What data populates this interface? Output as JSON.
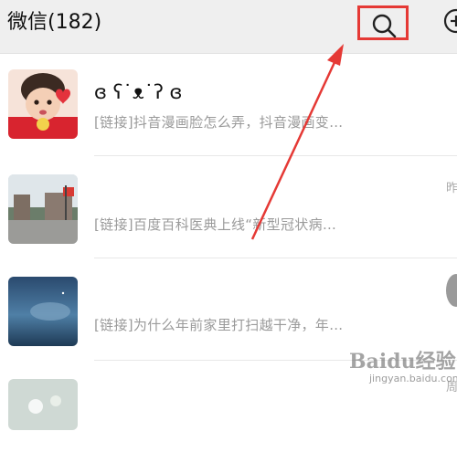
{
  "header": {
    "title": "微信(182)",
    "search_icon": "search-icon",
    "add_icon": "plus-circle-icon",
    "highlight_color": "#e53935"
  },
  "chats": [
    {
      "name": "ɞ ʕ˙ᴥ˙ʔ ɞ",
      "preview": "[链接]抖音漫画脸怎么弄，抖音漫画变…",
      "time": ""
    },
    {
      "name": "",
      "preview": "[链接]百度百科医典上线“新型冠状病…",
      "time": "昨"
    },
    {
      "name": "",
      "preview": "[链接]为什么年前家里打扫越干净，年…",
      "time": "周"
    },
    {
      "name": "",
      "preview": "",
      "time": ""
    }
  ],
  "watermark": {
    "brand": "Baidu经验",
    "url": "jingyan.baidu.com"
  },
  "annotation": {
    "color": "#e53935"
  }
}
